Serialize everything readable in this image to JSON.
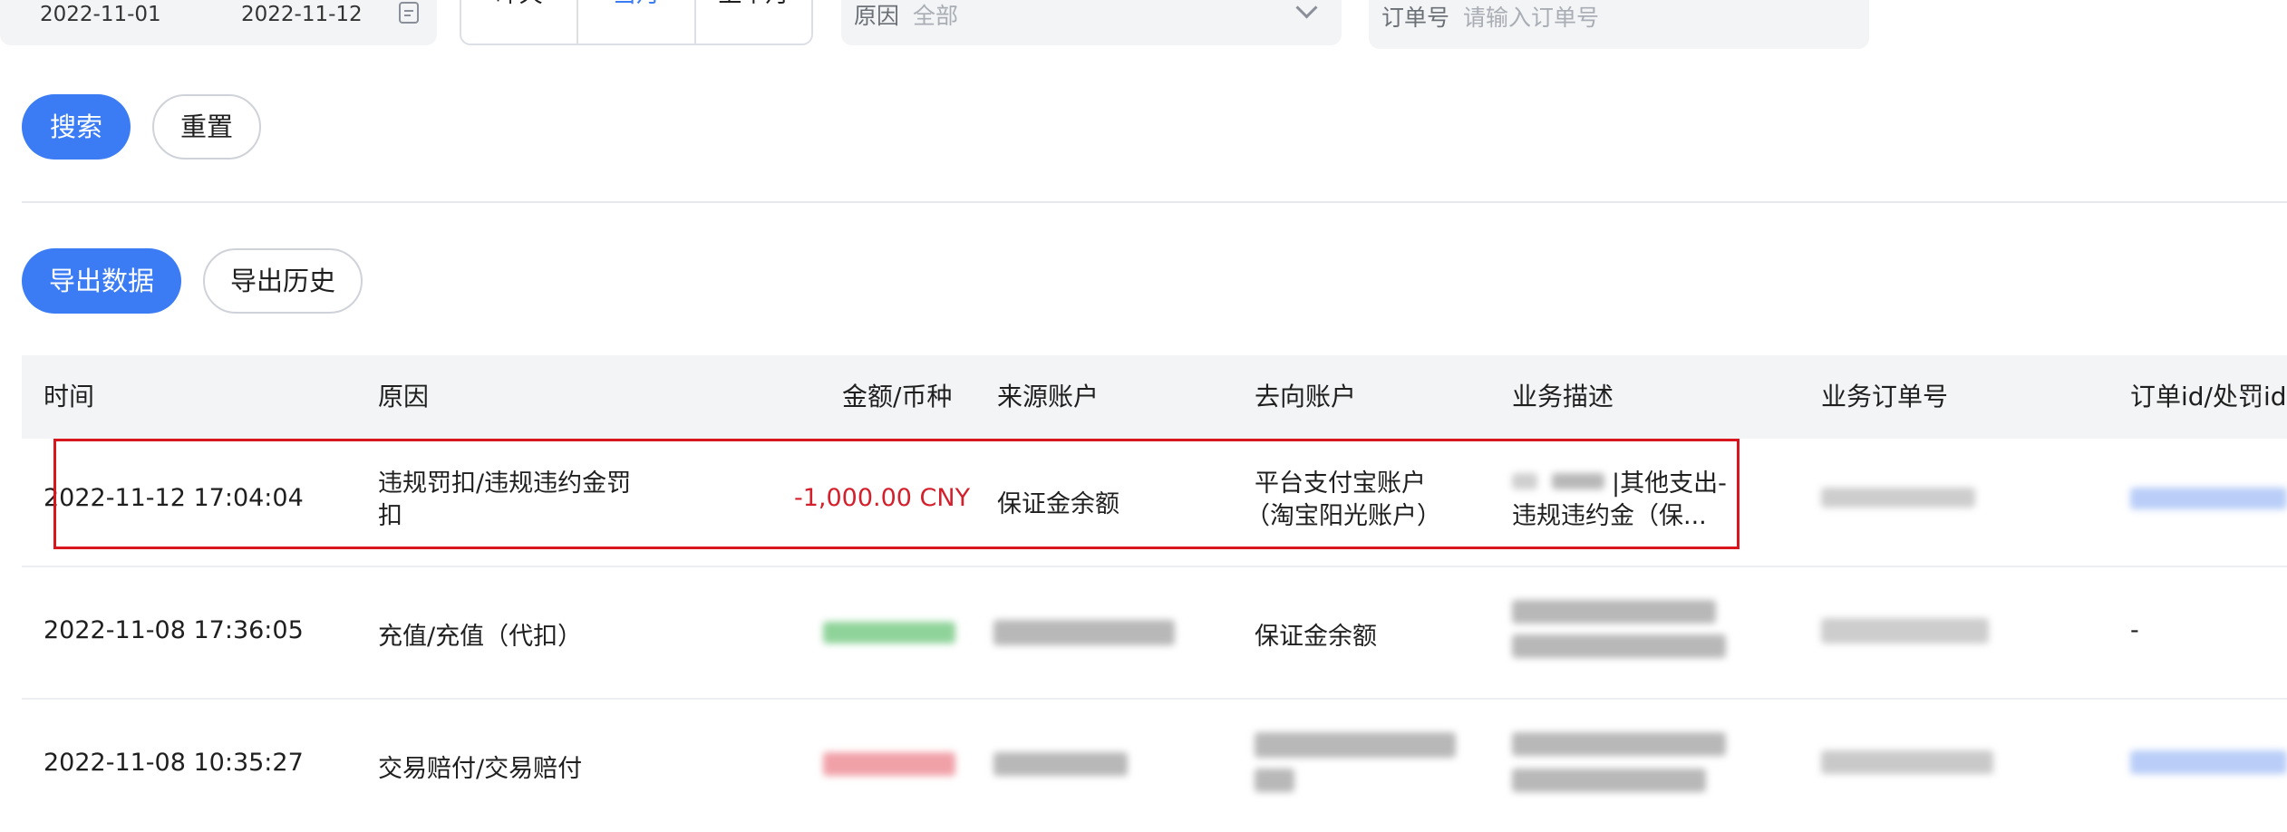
{
  "filters": {
    "date_start": "2022-11-01",
    "date_end": "2022-11-12",
    "quick_ranges": [
      "昨天",
      "当月",
      "上个月"
    ],
    "active_range": "当月",
    "reason_label": "原因",
    "reason_value": "全部",
    "order_label": "订单号",
    "order_placeholder": "请输入订单号"
  },
  "actions": {
    "search": "搜索",
    "reset": "重置",
    "export": "导出数据",
    "export_history": "导出历史"
  },
  "table": {
    "headers": [
      "时间",
      "原因",
      "金额/币种",
      "来源账户",
      "去向账户",
      "业务描述",
      "业务订单号",
      "订单id/处罚id"
    ],
    "rows": [
      {
        "time": "2022-11-12 17:04:04",
        "reason_line1": "违规罚扣/违规违约金罚",
        "reason_line2": "扣",
        "amount": "-1,000.00 CNY",
        "source": "保证金余额",
        "target_line1": "平台支付宝账户",
        "target_line2": "（淘宝阳光账户）",
        "desc_line1": "|其他支出-",
        "desc_line2": "违规违约金（保..."
      },
      {
        "time": "2022-11-08 17:36:05",
        "reason": "充值/充值（代扣）",
        "target": "保证金余额",
        "order_id": "-"
      },
      {
        "time": "2022-11-08 10:35:27",
        "reason": "交易赔付/交易赔付"
      }
    ]
  },
  "colors": {
    "primary": "#3b7cf5",
    "negative_amount": "#d4202c",
    "highlight_border": "#d9161e"
  }
}
